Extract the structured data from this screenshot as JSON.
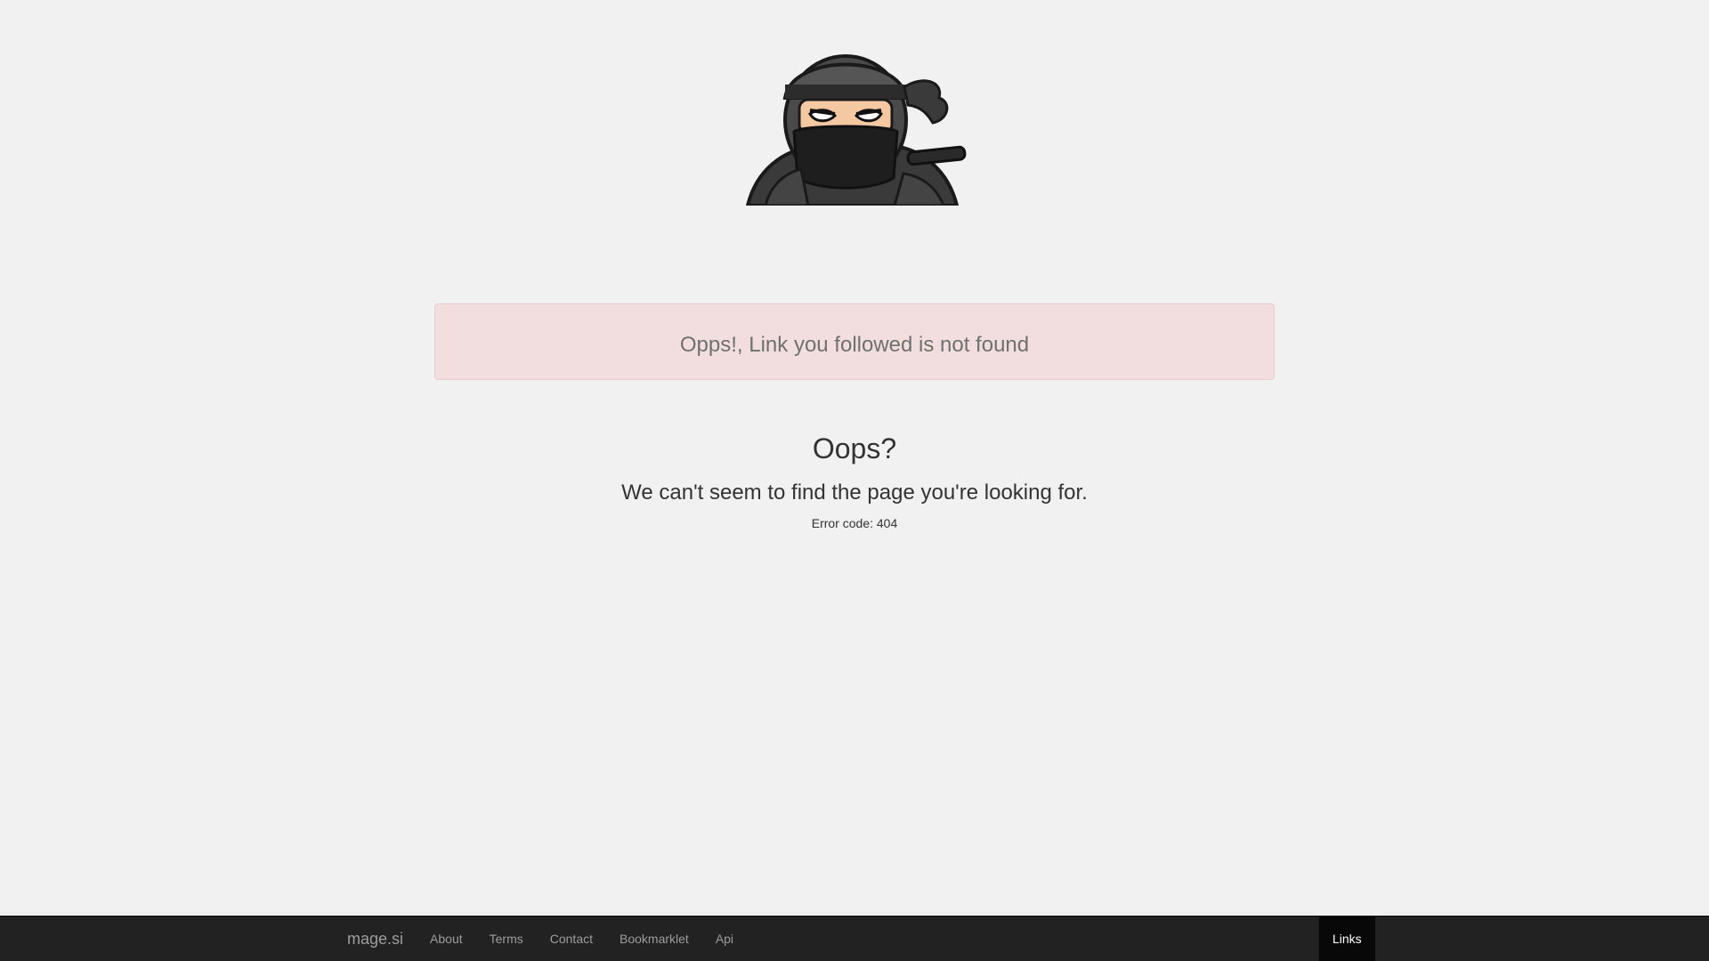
{
  "alert": {
    "message": "Opps!, Link you followed is not found"
  },
  "error": {
    "title": "Oops?",
    "subtitle": "We can't seem to find the page you're looking for.",
    "code_text": "Error code: 404"
  },
  "footer": {
    "brand": "mage.si",
    "links": [
      "About",
      "Terms",
      "Contact",
      "Bookmarklet",
      "Api"
    ],
    "active_link": "Links"
  },
  "mascot": {
    "icon": "ninja-mascot-icon"
  },
  "colors": {
    "background": "#f1f1f1",
    "alert_bg": "#f2dede",
    "alert_border": "#ebccd1",
    "footer_bg": "#222222",
    "footer_active_bg": "#080808"
  }
}
